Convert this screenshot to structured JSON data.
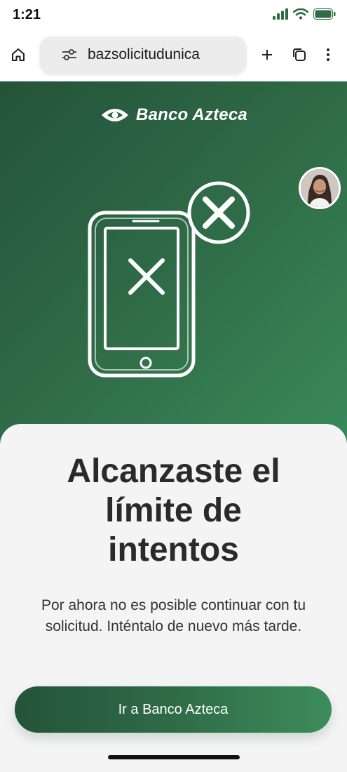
{
  "status_bar": {
    "time": "1:21",
    "icons": [
      "signal-icon",
      "wifi-icon",
      "battery-icon"
    ]
  },
  "browser": {
    "url": "bazsolicitudunica",
    "icons": [
      "home-icon",
      "tune-icon",
      "plus-icon",
      "tabs-icon",
      "more-icon"
    ]
  },
  "hero": {
    "brand": "Banco Azteca",
    "brand_color": "#ffffff",
    "gradient": [
      "#24533a",
      "#3a8a5a"
    ]
  },
  "message": {
    "title_lines": [
      "Alcanzaste el",
      "límite de",
      "intentos"
    ],
    "body_lines": [
      "Por ahora no es posible continuar con tu",
      "solicitud. Inténtalo de nuevo más tarde."
    ]
  },
  "cta": {
    "label": "Ir a Banco Azteca"
  }
}
